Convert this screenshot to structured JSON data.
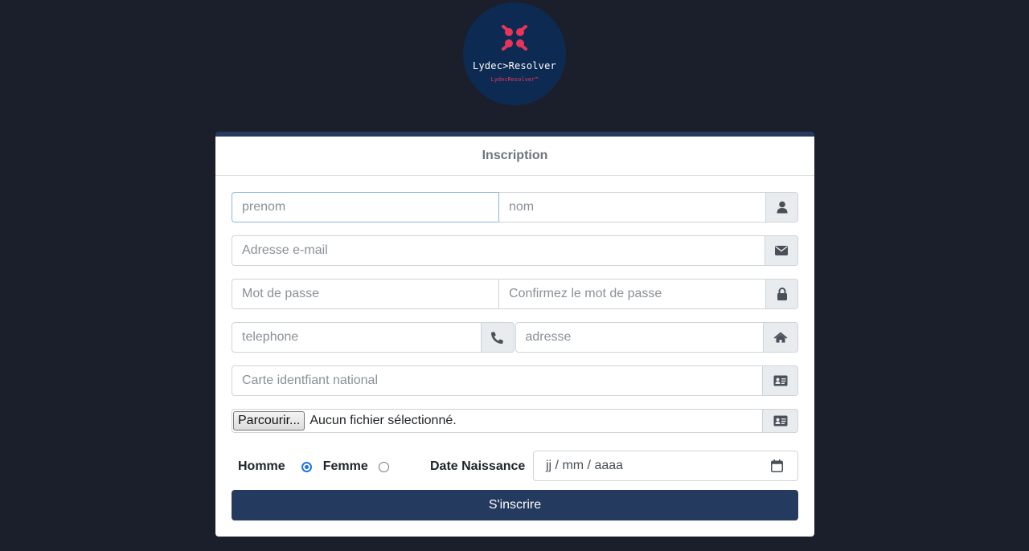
{
  "logo": {
    "name": "Lydec>Resolver",
    "tagline": "LydecResolver™",
    "icon": "resolver-logo-icon",
    "colors": {
      "circle": "#0d2b52",
      "accent": "#e8345a"
    }
  },
  "form": {
    "title": "Inscription",
    "first_name": {
      "placeholder": "prenom"
    },
    "last_name": {
      "placeholder": "nom"
    },
    "email": {
      "placeholder": "Adresse e-mail"
    },
    "password": {
      "placeholder": "Mot de passe"
    },
    "confirm_password": {
      "placeholder": "Confirmez le mot de passe"
    },
    "phone": {
      "placeholder": "telephone"
    },
    "address": {
      "placeholder": "adresse"
    },
    "national_id": {
      "placeholder": "Carte identfiant national"
    },
    "file": {
      "button_label": "Parcourir...",
      "status": "Aucun fichier sélectionné."
    },
    "gender": {
      "male_label": "Homme",
      "female_label": "Femme",
      "selected": "Homme"
    },
    "birth_date": {
      "label": "Date Naissance",
      "placeholder": "jj / mm / aaaa"
    },
    "submit_label": "S'inscrire"
  },
  "icons": {
    "name_addon": "user-icon",
    "email_addon": "envelope-icon",
    "password_addon": "lock-icon",
    "phone_addon": "phone-icon",
    "address_addon": "home-icon",
    "id_addon": "id-card-icon",
    "file_addon": "id-card-icon",
    "date": "calendar-icon"
  },
  "colors": {
    "background": "#1b1f2b",
    "primary": "#243a5e",
    "radio_selected": "#1a73e8"
  }
}
